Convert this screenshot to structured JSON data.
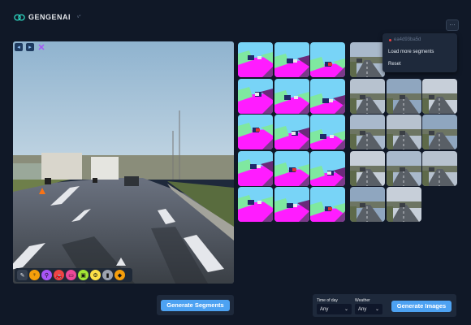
{
  "app": {
    "name": "GENGENAI",
    "version": "v*"
  },
  "menu": {
    "more_label": "…",
    "session_id": "ea4d93ba5d",
    "items": [
      "Load more segments",
      "Reset"
    ]
  },
  "editor": {
    "tools": [
      "back-icon",
      "forward-icon",
      "close-icon"
    ],
    "palette": [
      {
        "name": "eraser",
        "color": "#374151",
        "glyph": "✎"
      },
      {
        "name": "person",
        "color": "#f59e0b",
        "glyph": "♀"
      },
      {
        "name": "rider",
        "color": "#a855f7",
        "glyph": "⚲"
      },
      {
        "name": "car",
        "color": "#ef4444",
        "glyph": "🚗"
      },
      {
        "name": "truck",
        "color": "#ec4899",
        "glyph": "▭"
      },
      {
        "name": "bus",
        "color": "#a3e635",
        "glyph": "▣"
      },
      {
        "name": "motorcycle",
        "color": "#fde047",
        "glyph": "⚙"
      },
      {
        "name": "traffic-light",
        "color": "#9ca3af",
        "glyph": "▮"
      },
      {
        "name": "traffic-sign",
        "color": "#f59e0b",
        "glyph": "◆"
      }
    ]
  },
  "segments_label": "Generate Segments",
  "controls": {
    "time_label": "Time of day",
    "time_value": "Any",
    "weather_label": "Weather",
    "weather_value": "Any",
    "generate_label": "Generate Images"
  },
  "colors": {
    "accent": "#4da2f2",
    "bg": "#101827",
    "panel": "#1e293b",
    "seg_road": "#ff1cff",
    "seg_sky": "#78d4f7",
    "seg_veg": "#7fe8a0"
  }
}
